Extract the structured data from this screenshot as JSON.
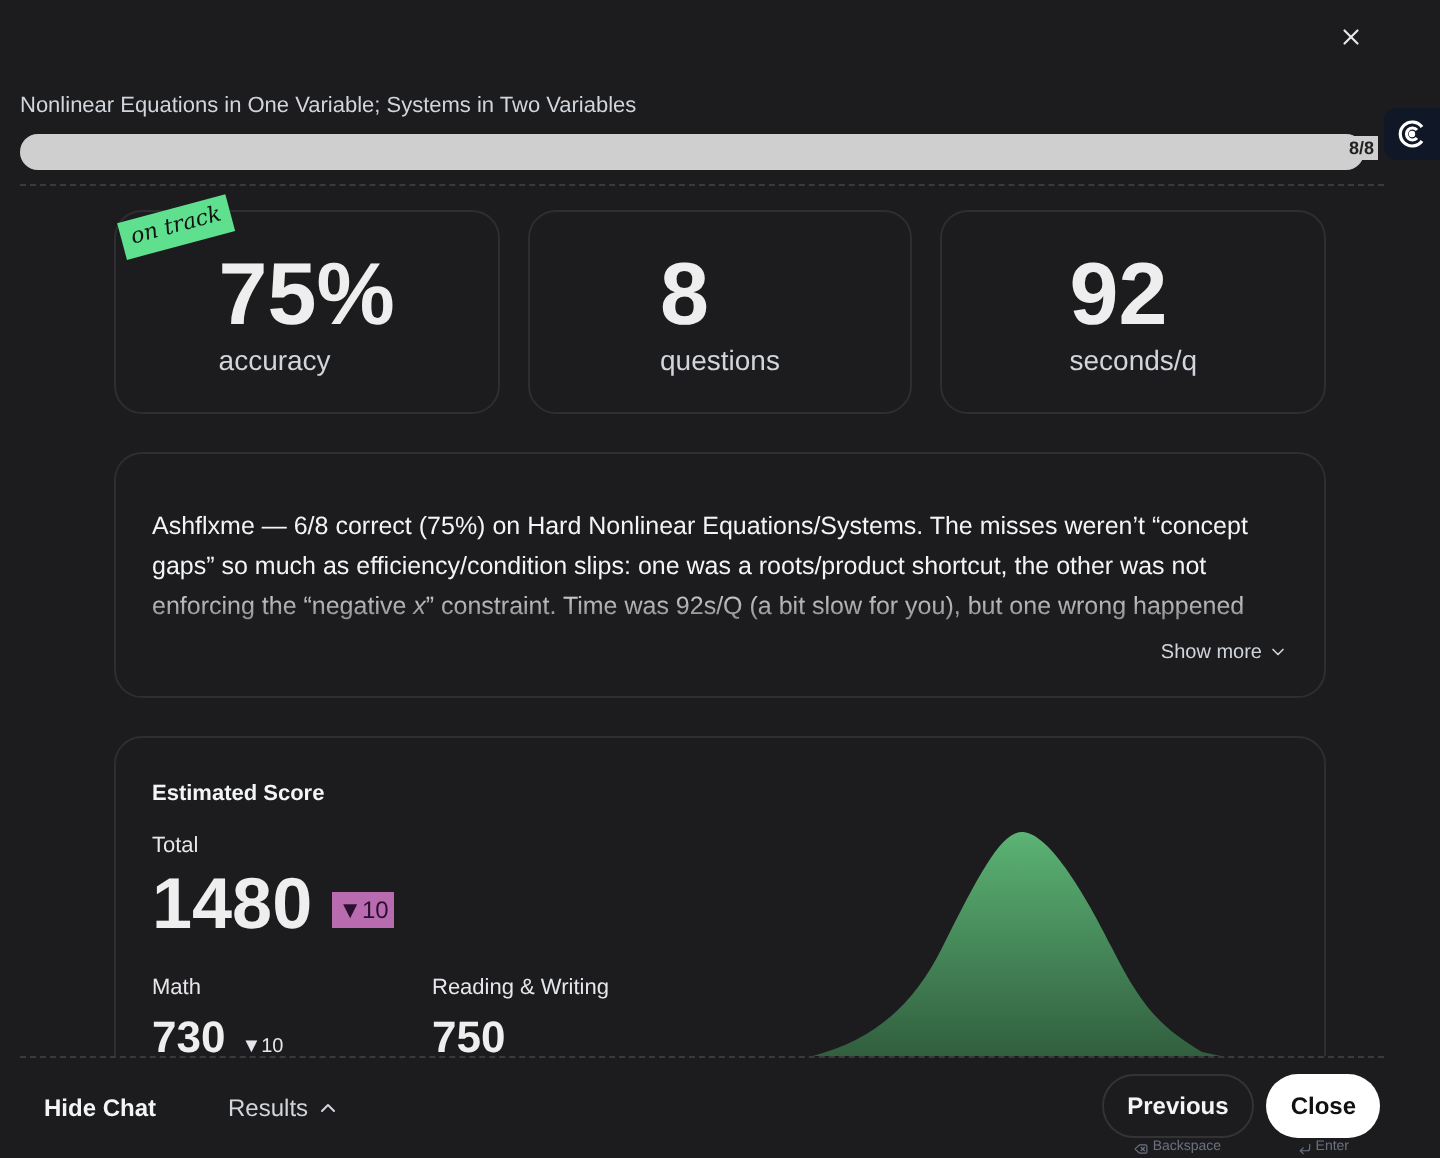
{
  "title": "Nonlinear Equations in One Variable; Systems in Two Variables",
  "progress": {
    "level": 1,
    "label": "8/8"
  },
  "stats": [
    {
      "value": "75%",
      "label": "accuracy",
      "badge": "on track"
    },
    {
      "value": "8",
      "label": "questions"
    },
    {
      "value": "92",
      "label": "seconds/q"
    }
  ],
  "summary": {
    "text": "Ashflxme — 6/8 correct (75%) on Hard Nonlinear Equations/Systems. The misses weren’t “concept gaps” so much as efficiency/condition slips: one was a roots/product shortcut, the other was not enforcing the “negative *x*” constraint. Time was 92s/Q (a bit slow for you), but one wrong happened",
    "show_more": "Show more"
  },
  "score": {
    "title": "Estimated Score",
    "total_label": "Total",
    "total": "1480",
    "total_change": "▼10",
    "sections": [
      {
        "label": "Math",
        "value": "730",
        "change": "▼10"
      },
      {
        "label": "Reading & Writing",
        "value": "750"
      }
    ]
  },
  "footer": {
    "hide_chat": "Hide Chat",
    "results": "Results",
    "previous": "Previous",
    "previous_key": "Backspace",
    "close": "Close",
    "close_key": "Enter"
  }
}
